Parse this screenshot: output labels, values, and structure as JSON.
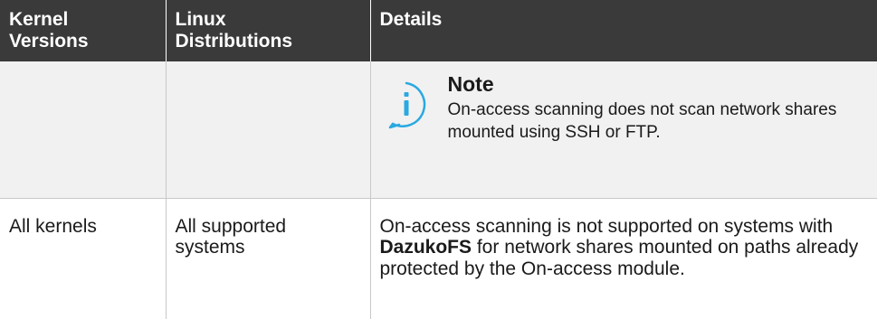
{
  "table": {
    "headers": [
      "Kernel Versions",
      "Linux Distributions",
      "Details"
    ],
    "header_lines": [
      [
        "Kernel",
        "Versions"
      ],
      [
        "Linux",
        "Distributions"
      ],
      [
        "Details"
      ]
    ],
    "note_row": {
      "kernel": "",
      "distribution": "",
      "note": {
        "icon": "info-icon",
        "icon_color": "#29a9e1",
        "title": "Note",
        "text": "On-access scanning does not scan network shares mounted using SSH or FTP."
      }
    },
    "rows": [
      {
        "kernel": "All kernels",
        "distribution_lines": [
          "All supported",
          "systems"
        ],
        "details": {
          "before": "On-access scanning is not supported on systems with ",
          "bold": "DazukoFS",
          "after": " for network shares mounted on paths already protected by the On-access module."
        }
      }
    ]
  },
  "colors": {
    "header_background": "#3a3a3a",
    "header_text": "#ffffff",
    "note_background": "#f1f1f1",
    "accent": "#29a9e1"
  }
}
